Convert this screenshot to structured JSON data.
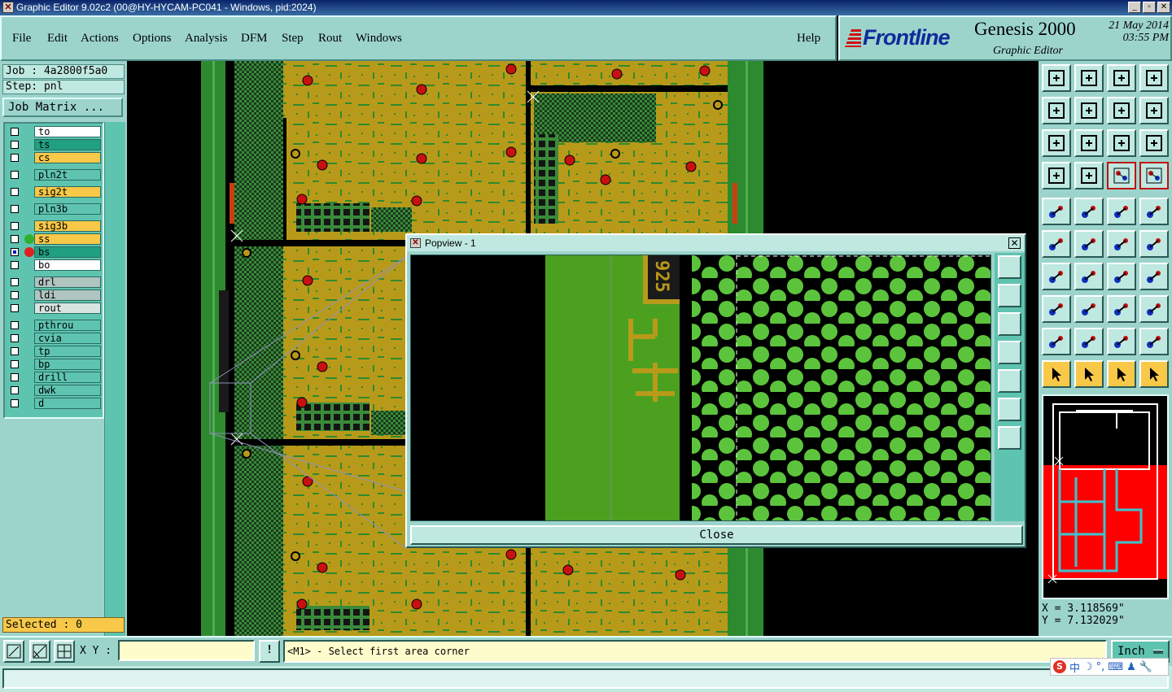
{
  "window": {
    "title": "Graphic Editor 9.02c2 (00@HY-HYCAM-PC041 - Windows, pid:2024)"
  },
  "menu": [
    "File",
    "Edit",
    "Actions",
    "Options",
    "Analysis",
    "DFM",
    "Step",
    "Rout",
    "Windows"
  ],
  "help_label": "Help",
  "brand": {
    "logo": "Frontline",
    "product": "Genesis 2000",
    "date": "21 May 2014",
    "time": "03:55 PM",
    "subtitle": "Graphic Editor"
  },
  "job_label": "Job : 4a2800f5a0",
  "step_label": "Step: pnl",
  "job_matrix_label": "Job Matrix ...",
  "layers": [
    {
      "name": "to",
      "color": "#ffffff",
      "dot": ""
    },
    {
      "name": "ts",
      "color": "#20a080",
      "dot": ""
    },
    {
      "name": "cs",
      "color": "#f8c848",
      "dot": ""
    },
    {
      "name": "pln2t",
      "color": "#5ec4b0",
      "dot": ""
    },
    {
      "name": "sig2t",
      "color": "#f8c848",
      "dot": ""
    },
    {
      "name": "pln3b",
      "color": "#5ec4b0",
      "dot": ""
    },
    {
      "name": "sig3b",
      "color": "#f8c848",
      "dot": ""
    },
    {
      "name": "ss",
      "color": "#f8c848",
      "dot": "#30b030"
    },
    {
      "name": "bs",
      "color": "#20a080",
      "dot": "#e02020"
    },
    {
      "name": "bo",
      "color": "#ffffff",
      "dot": ""
    },
    {
      "name": "drl",
      "color": "#b0c4c0",
      "dot": ""
    },
    {
      "name": "ldi",
      "color": "#b0c4c0",
      "dot": ""
    },
    {
      "name": "rout",
      "color": "#d8e4e0",
      "dot": ""
    },
    {
      "name": "pthrou",
      "color": "#5ec4b0",
      "dot": ""
    },
    {
      "name": "cvia",
      "color": "#5ec4b0",
      "dot": ""
    },
    {
      "name": "tp",
      "color": "#5ec4b0",
      "dot": ""
    },
    {
      "name": "bp",
      "color": "#5ec4b0",
      "dot": ""
    },
    {
      "name": "drill",
      "color": "#5ec4b0",
      "dot": ""
    },
    {
      "name": "dwk",
      "color": "#5ec4b0",
      "dot": ""
    },
    {
      "name": "d",
      "color": "#5ec4b0",
      "dot": ""
    }
  ],
  "selected_label": "Selected : 0",
  "popview": {
    "title": "Popview - 1",
    "close_label": "Close",
    "pad_text": "925"
  },
  "coords": {
    "x": "X = 3.118569\"",
    "y": "Y = 7.132029\""
  },
  "bottom": {
    "xy_label": "X Y :",
    "xy_value": "",
    "excl": "!",
    "prompt": "<M1> - Select first area corner",
    "units": "Inch"
  },
  "ime": {
    "s": "S",
    "zh": "中",
    "moon": "☽",
    "deg": "°,",
    "kbd": "⌨",
    "user": "♟",
    "tool": "🔧"
  },
  "colors": {
    "panel": "#9cd4cc",
    "copper": "#b89a1a",
    "green": "#2e8a2e",
    "pad_green": "#5cc43c",
    "drill_red": "#c81010"
  }
}
